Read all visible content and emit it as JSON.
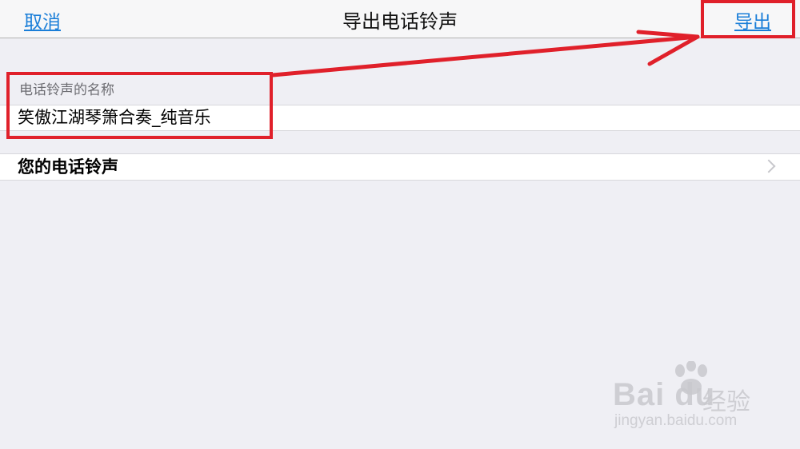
{
  "navbar": {
    "cancel_label": "取消",
    "title": "导出电话铃声",
    "export_label": "导出"
  },
  "name_section": {
    "header": "电话铃声的名称",
    "value": "笑傲江湖琴箫合奏_纯音乐"
  },
  "ringtones_row": {
    "label": "您的电话铃声",
    "icon": "chevron-right-icon"
  },
  "watermark": {
    "brand": "Bai du",
    "cn": "经验",
    "url": "jingyan.baidu.com"
  },
  "colors": {
    "accent": "#1a7ed8",
    "background": "#efeff4",
    "annotation": "#e0202a"
  }
}
